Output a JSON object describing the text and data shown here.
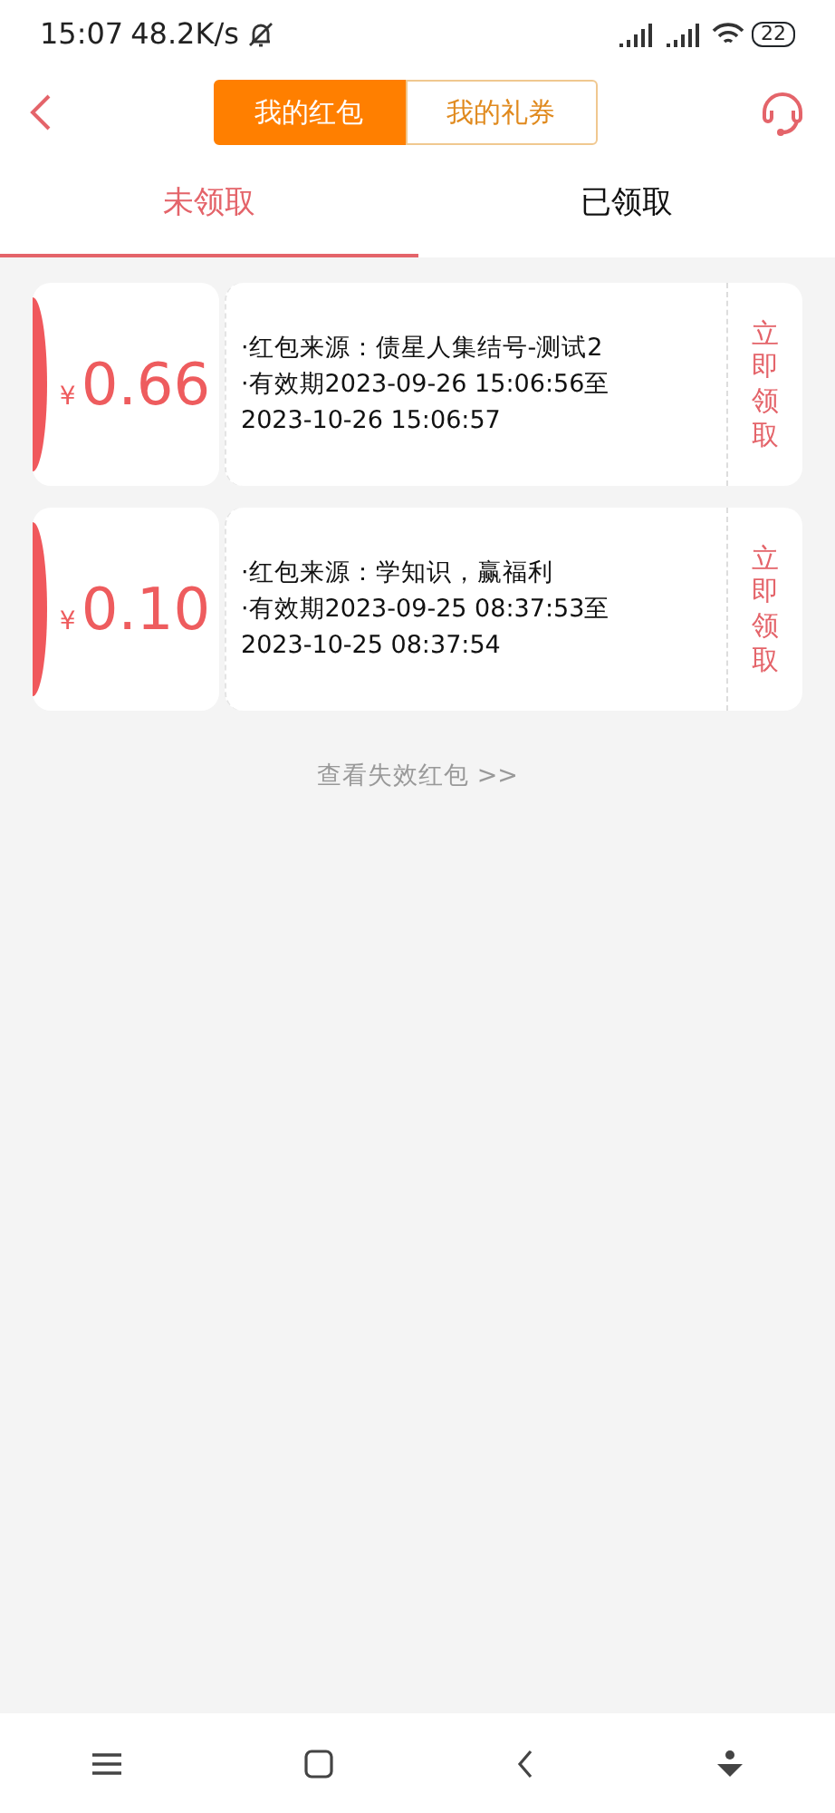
{
  "status_bar": {
    "time": "15:07",
    "speed": "48.2K/s",
    "battery": "22"
  },
  "header": {
    "segments": [
      {
        "label": "我的红包",
        "selected": true
      },
      {
        "label": "我的礼券",
        "selected": false
      }
    ]
  },
  "tabs": [
    {
      "label": "未领取",
      "selected": true
    },
    {
      "label": "已领取",
      "selected": false
    }
  ],
  "packets": [
    {
      "currency": "¥",
      "amount": "0.66",
      "source": "·红包来源：债星人集结号-测试2",
      "validity": [
        "·有效期2023-09-26 15:06:56至",
        "2023-10-26 15:06:57"
      ],
      "action": "立即领取"
    },
    {
      "currency": "¥",
      "amount": "0.10",
      "source": "·红包来源：学知识，赢福利",
      "validity": [
        "·有效期2023-09-25 08:37:53至",
        "2023-10-25 08:37:54"
      ],
      "action": "立即领取"
    }
  ],
  "expired_link": "查看失效红包 >>"
}
